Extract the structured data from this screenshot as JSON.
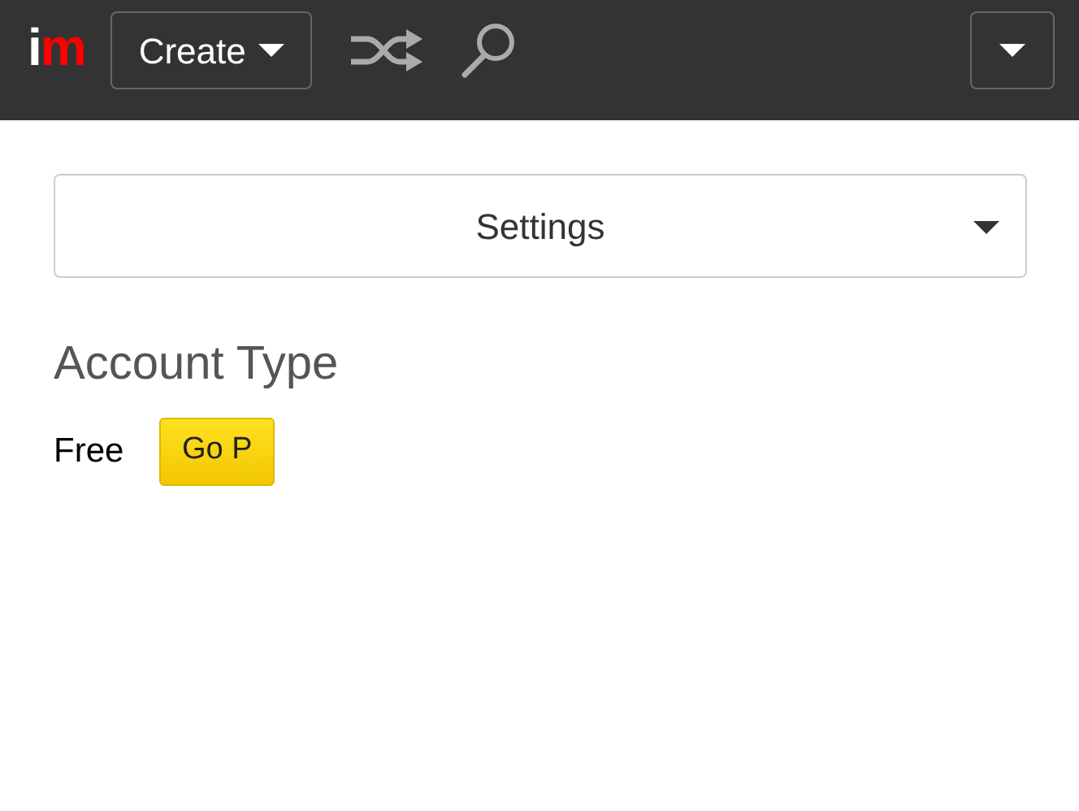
{
  "navbar": {
    "logo": [
      "i",
      "m"
    ],
    "create_button": "Create"
  },
  "settings_select": {
    "value": "Settings"
  },
  "section": {
    "heading": "Account Type",
    "plan": "Free",
    "upgrade_button": "Go P"
  }
}
